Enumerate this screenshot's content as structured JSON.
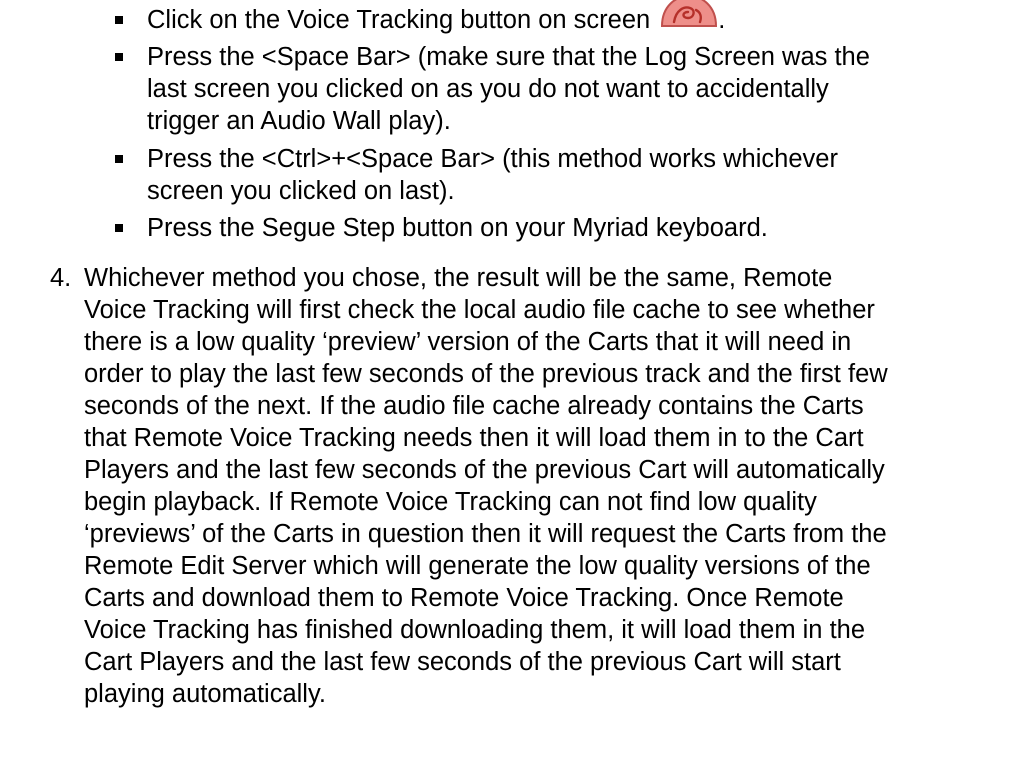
{
  "bullets": [
    {
      "text_before_icon": "Click on the Voice Tracking button on screen",
      "icon": "voice-tracking-button-icon",
      "text_after_icon": "."
    },
    {
      "text": "Press the <Space Bar> (make sure that the Log Screen was the\nlast screen you clicked on as you do not want to accidentally\ntrigger an Audio Wall play)."
    },
    {
      "text": "Press the <Ctrl>+<Space Bar> (this method works whichever\nscreen you clicked on last)."
    },
    {
      "text": "Press the Segue Step button on your Myriad keyboard."
    }
  ],
  "numbered_item": {
    "number": "4.",
    "text": "Whichever method you chose, the result will be the same, Remote\nVoice Tracking will first check the local audio file cache to see whether\nthere is a low quality ‘preview’ version of the Carts that it will need in\norder to play the last few seconds of the previous track and the first few\nseconds of the next. If the audio file cache already contains the Carts\nthat Remote Voice Tracking needs then it will load them in to the Cart\nPlayers and the last few seconds of the previous Cart will automatically\nbegin playback. If Remote Voice Tracking can not find low quality\n‘previews’ of the Carts in question then it will request the Carts from the\nRemote Edit Server which will generate the low quality versions of the\nCarts and download them to Remote Voice Tracking. Once Remote\nVoice Tracking has finished downloading them, it will load them in the\nCart Players and the last few seconds of the previous Cart will start\nplaying automatically."
  },
  "colors": {
    "text": "#000000",
    "background": "#ffffff",
    "icon_fill": "#ee8f8a",
    "icon_stroke": "#c0504d"
  }
}
